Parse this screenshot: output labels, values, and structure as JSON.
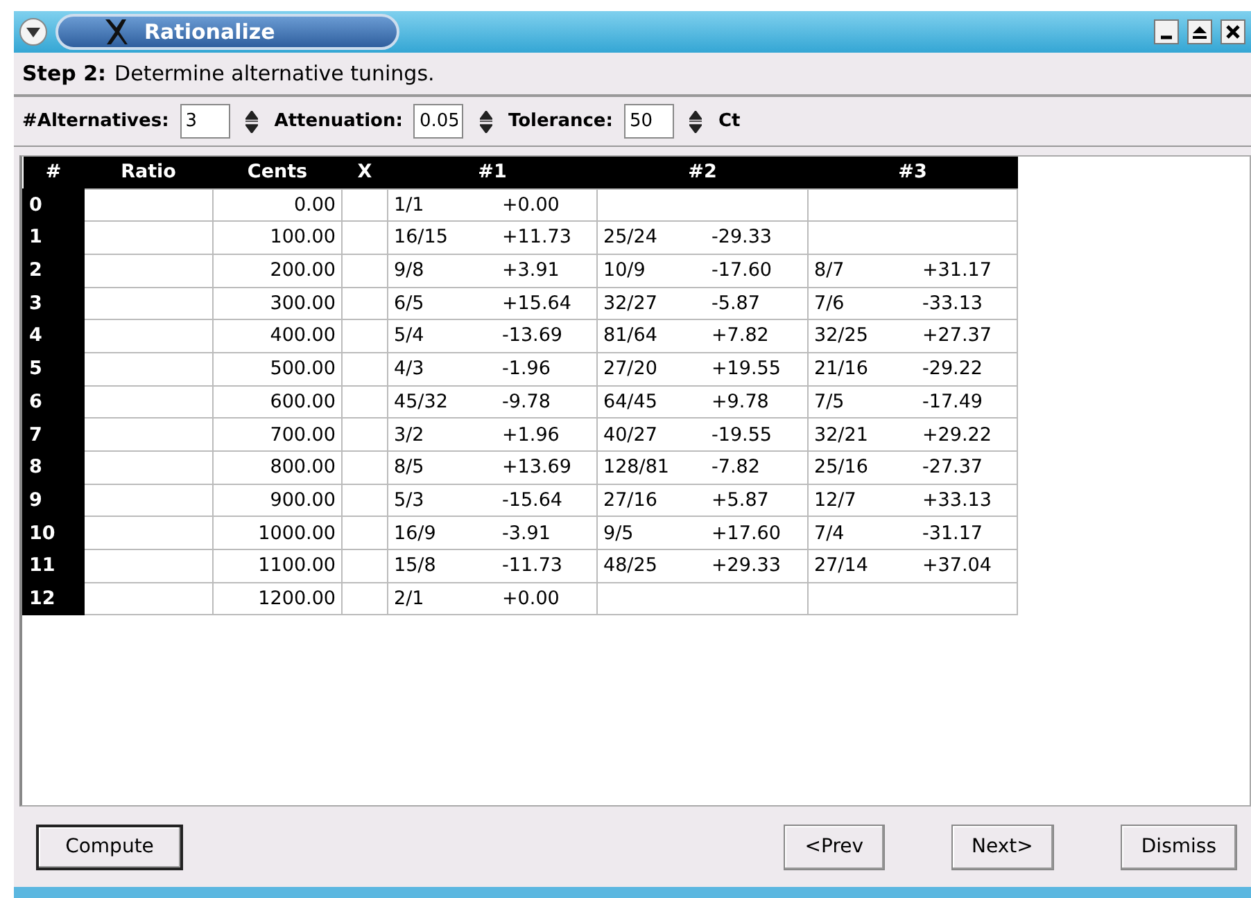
{
  "window": {
    "title": "Rationalize"
  },
  "step": {
    "label": "Step 2:",
    "text": "Determine alternative tunings."
  },
  "parameters": [
    {
      "label": "#Alternatives:",
      "value": "3"
    },
    {
      "label": "Attenuation:",
      "value": "0.05"
    },
    {
      "label": "Tolerance:",
      "value": "50",
      "unit": "Ct"
    }
  ],
  "table": {
    "columns": [
      "#",
      "Ratio",
      "Cents",
      "X",
      "#1",
      "#2",
      "#3"
    ],
    "rows": [
      {
        "index": "0",
        "cents": "0.00",
        "alternatives": [
          {
            "ratio": "1/1",
            "deviation": "+0.00"
          }
        ]
      },
      {
        "index": "1",
        "cents": "100.00",
        "alternatives": [
          {
            "ratio": "16/15",
            "deviation": "+11.73"
          },
          {
            "ratio": "25/24",
            "deviation": "-29.33"
          }
        ]
      },
      {
        "index": "2",
        "cents": "200.00",
        "alternatives": [
          {
            "ratio": "9/8",
            "deviation": "+3.91"
          },
          {
            "ratio": "10/9",
            "deviation": "-17.60"
          },
          {
            "ratio": "8/7",
            "deviation": "+31.17"
          }
        ]
      },
      {
        "index": "3",
        "cents": "300.00",
        "alternatives": [
          {
            "ratio": "6/5",
            "deviation": "+15.64"
          },
          {
            "ratio": "32/27",
            "deviation": "-5.87"
          },
          {
            "ratio": "7/6",
            "deviation": "-33.13"
          }
        ]
      },
      {
        "index": "4",
        "cents": "400.00",
        "alternatives": [
          {
            "ratio": "5/4",
            "deviation": "-13.69"
          },
          {
            "ratio": "81/64",
            "deviation": "+7.82"
          },
          {
            "ratio": "32/25",
            "deviation": "+27.37"
          }
        ]
      },
      {
        "index": "5",
        "cents": "500.00",
        "alternatives": [
          {
            "ratio": "4/3",
            "deviation": "-1.96"
          },
          {
            "ratio": "27/20",
            "deviation": "+19.55"
          },
          {
            "ratio": "21/16",
            "deviation": "-29.22"
          }
        ]
      },
      {
        "index": "6",
        "cents": "600.00",
        "alternatives": [
          {
            "ratio": "45/32",
            "deviation": "-9.78"
          },
          {
            "ratio": "64/45",
            "deviation": "+9.78"
          },
          {
            "ratio": "7/5",
            "deviation": "-17.49"
          }
        ]
      },
      {
        "index": "7",
        "cents": "700.00",
        "alternatives": [
          {
            "ratio": "3/2",
            "deviation": "+1.96"
          },
          {
            "ratio": "40/27",
            "deviation": "-19.55"
          },
          {
            "ratio": "32/21",
            "deviation": "+29.22"
          }
        ]
      },
      {
        "index": "8",
        "cents": "800.00",
        "alternatives": [
          {
            "ratio": "8/5",
            "deviation": "+13.69"
          },
          {
            "ratio": "128/81",
            "deviation": "-7.82"
          },
          {
            "ratio": "25/16",
            "deviation": "-27.37"
          }
        ]
      },
      {
        "index": "9",
        "cents": "900.00",
        "alternatives": [
          {
            "ratio": "5/3",
            "deviation": "-15.64"
          },
          {
            "ratio": "27/16",
            "deviation": "+5.87"
          },
          {
            "ratio": "12/7",
            "deviation": "+33.13"
          }
        ]
      },
      {
        "index": "10",
        "cents": "1000.00",
        "alternatives": [
          {
            "ratio": "16/9",
            "deviation": "-3.91"
          },
          {
            "ratio": "9/5",
            "deviation": "+17.60"
          },
          {
            "ratio": "7/4",
            "deviation": "-31.17"
          }
        ]
      },
      {
        "index": "11",
        "cents": "1100.00",
        "alternatives": [
          {
            "ratio": "15/8",
            "deviation": "-11.73"
          },
          {
            "ratio": "48/25",
            "deviation": "+29.33"
          },
          {
            "ratio": "27/14",
            "deviation": "+37.04"
          }
        ]
      },
      {
        "index": "12",
        "cents": "1200.00",
        "alternatives": [
          {
            "ratio": "2/1",
            "deviation": "+0.00"
          }
        ]
      }
    ]
  },
  "buttons": [
    {
      "label": "Compute",
      "default": true
    },
    {
      "label": "<Prev",
      "default": false
    },
    {
      "label": "Next>",
      "default": false
    },
    {
      "label": "Dismiss",
      "default": false
    }
  ]
}
